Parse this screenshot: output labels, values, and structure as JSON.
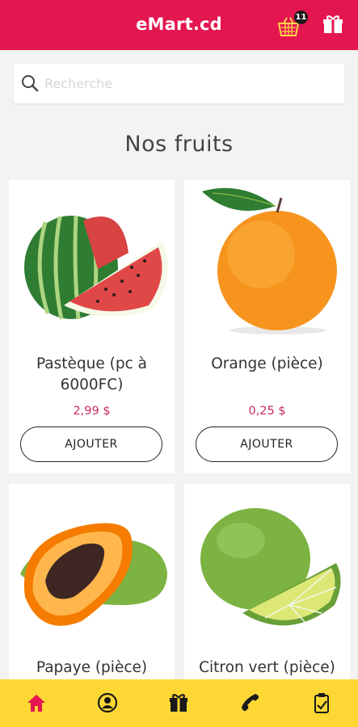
{
  "app": {
    "title": "eMart.cd",
    "cart_count": "11"
  },
  "search": {
    "placeholder": "Recherche"
  },
  "section_title": "Nos fruits",
  "products": [
    {
      "name": "Pastèque (pc à 6000FC)",
      "price": "2,99 $",
      "button": "AJOUTER"
    },
    {
      "name": "Orange (pièce)",
      "price": "0,25 $",
      "button": "AJOUTER"
    },
    {
      "name": "Papaye (pièce)"
    },
    {
      "name": "Citron vert (pièce)"
    }
  ],
  "bottom_nav": [
    "home-icon",
    "account-icon",
    "gift-icon",
    "phone-icon",
    "orders-icon"
  ],
  "colors": {
    "header": "#e3164f",
    "price": "#c72a66",
    "bottom_nav": "#fdd835",
    "background": "#f3f3f3"
  }
}
